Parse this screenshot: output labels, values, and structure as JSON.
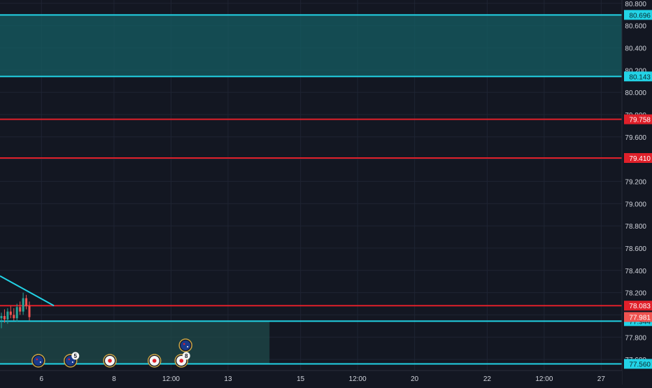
{
  "colors": {
    "background": "#131722",
    "grid": "#1f2433",
    "cyan": "#22d3e6",
    "red": "#e0202a",
    "zone_fill": "#155e63",
    "lower_zone_fill": "#1f4a49",
    "axis_text": "#d1d4dc",
    "candle_green": "#26a69a",
    "candle_red": "#ef5350",
    "current_price_bg": "#ef5350"
  },
  "price_axis": {
    "min": 77.5,
    "max": 80.83,
    "tick_labels": [
      "80.800",
      "80.600",
      "80.400",
      "80.200",
      "80.000",
      "79.800",
      "79.600",
      "79.400",
      "79.200",
      "79.000",
      "78.800",
      "78.600",
      "78.400",
      "78.200",
      "78.000",
      "77.800",
      "77.600"
    ],
    "tick_values": [
      80.8,
      80.6,
      80.4,
      80.2,
      80.0,
      79.8,
      79.6,
      79.4,
      79.2,
      79.0,
      78.8,
      78.6,
      78.4,
      78.2,
      78.0,
      77.8,
      77.6
    ]
  },
  "time_axis": {
    "labels": [
      {
        "text": "6",
        "slot": 4
      },
      {
        "text": "8",
        "slot": 11
      },
      {
        "text": "12:00",
        "slot": 16.5
      },
      {
        "text": "13",
        "slot": 22
      },
      {
        "text": "15",
        "slot": 29
      },
      {
        "text": "12:00",
        "slot": 34.5
      },
      {
        "text": "20",
        "slot": 40
      },
      {
        "text": "22",
        "slot": 47
      },
      {
        "text": "12:00",
        "slot": 52.5
      },
      {
        "text": "27",
        "slot": 58
      }
    ],
    "slots_visible": 60
  },
  "levels": [
    {
      "name": "cyan-level-80696",
      "price": 80.696,
      "label": "80.696",
      "color": "cyan"
    },
    {
      "name": "cyan-level-80143",
      "price": 80.143,
      "label": "80.143",
      "color": "cyan"
    },
    {
      "name": "red-level-79758",
      "price": 79.758,
      "label": "79.758",
      "color": "red"
    },
    {
      "name": "red-level-79410",
      "price": 79.41,
      "label": "79.410",
      "color": "red"
    },
    {
      "name": "red-level-78083",
      "price": 78.083,
      "label": "78.083",
      "color": "red"
    },
    {
      "name": "cyan-level-77944",
      "price": 77.944,
      "label": "77.944",
      "color": "cyan"
    },
    {
      "name": "cyan-level-77560",
      "price": 77.56,
      "label": "77.560",
      "color": "cyan"
    }
  ],
  "current_price": {
    "price": 77.981,
    "label": "77.981"
  },
  "zones": [
    {
      "name": "upper-supply-zone",
      "top": 80.696,
      "bottom": 80.143,
      "slot_start": 0,
      "slot_end": 60,
      "fill": "zone_fill"
    },
    {
      "name": "lower-demand-zone",
      "top": 77.944,
      "bottom": 77.56,
      "slot_start": 0,
      "slot_end": 26,
      "fill": "lower_zone_fill"
    }
  ],
  "trendline": {
    "start": {
      "slot": 0,
      "price": 78.35
    },
    "end": {
      "slot": 5.2,
      "price": 78.083
    }
  },
  "candles": [
    {
      "slot": 0.0,
      "o": 77.97,
      "h": 78.02,
      "l": 77.88,
      "c": 77.99
    },
    {
      "slot": 0.3,
      "o": 77.99,
      "h": 78.05,
      "l": 77.93,
      "c": 77.96
    },
    {
      "slot": 0.6,
      "o": 77.96,
      "h": 78.06,
      "l": 77.92,
      "c": 78.03
    },
    {
      "slot": 0.9,
      "o": 78.03,
      "h": 78.08,
      "l": 77.97,
      "c": 78.0
    },
    {
      "slot": 1.2,
      "o": 78.0,
      "h": 78.06,
      "l": 77.95,
      "c": 77.97
    },
    {
      "slot": 1.5,
      "o": 77.97,
      "h": 78.1,
      "l": 77.94,
      "c": 78.07
    },
    {
      "slot": 1.8,
      "o": 78.07,
      "h": 78.12,
      "l": 78.0,
      "c": 78.03
    },
    {
      "slot": 2.1,
      "o": 78.03,
      "h": 78.2,
      "l": 78.0,
      "c": 78.15
    },
    {
      "slot": 2.4,
      "o": 78.15,
      "h": 78.18,
      "l": 78.05,
      "c": 78.08
    },
    {
      "slot": 2.7,
      "o": 78.08,
      "h": 78.12,
      "l": 77.95,
      "c": 77.98
    }
  ],
  "events": [
    {
      "name": "au-event-icon",
      "slot": 3.7,
      "kind": "flag-au",
      "badge": ""
    },
    {
      "name": "au-event-stack-icon",
      "slot": 6.8,
      "kind": "flag-au",
      "badge": "5"
    },
    {
      "name": "jp-event-icon",
      "slot": 10.6,
      "kind": "flag-jp",
      "badge": ""
    },
    {
      "name": "jp-event-icon-2",
      "slot": 14.9,
      "kind": "flag-jp",
      "badge": ""
    },
    {
      "name": "jp-event-stack-icon",
      "slot": 17.5,
      "kind": "flag-jp",
      "badge": "8"
    },
    {
      "name": "au-event-upper-icon",
      "slot": 17.9,
      "kind": "flag-au-raised",
      "badge": ""
    }
  ]
}
